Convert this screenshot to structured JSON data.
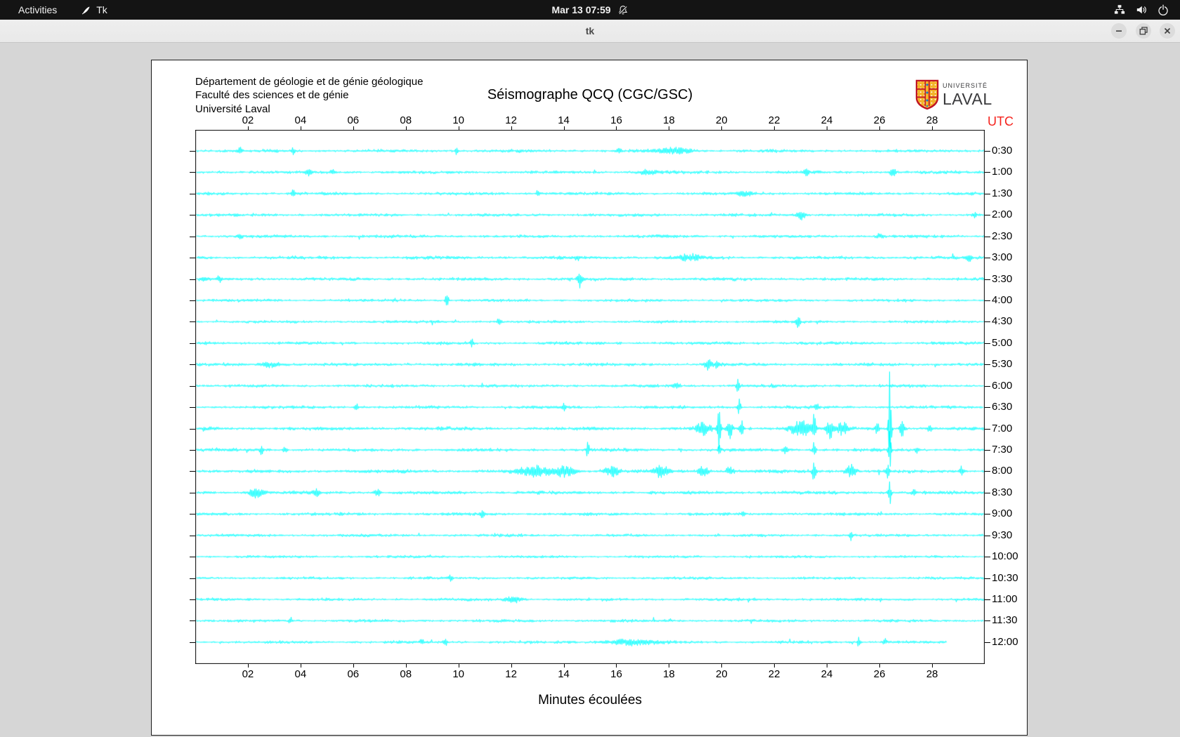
{
  "topbar": {
    "activities_label": "Activities",
    "app_name": "Tk",
    "clock": "Mar 13 07:59",
    "icons": [
      "tk-feather-icon",
      "bell-slash-icon",
      "wired-network-icon",
      "speaker-volume-icon",
      "power-icon"
    ]
  },
  "titlebar": {
    "title": "tk"
  },
  "header": {
    "org_line1": "Département de géologie et de génie géologique",
    "org_line2": "Faculté des sciences et de génie",
    "org_line3": "Université Laval",
    "title": "Séismographe QCQ (CGC/GSC)"
  },
  "logo": {
    "top": "UNIVERSITÉ",
    "bottom": "LAVAL",
    "shield_red": "#c01423",
    "shield_gold": "#f3b229",
    "shield_blue": "#1878be"
  },
  "axes": {
    "utc_label": "UTC",
    "utc_color": "#f5231d",
    "x_caption": "Minutes écoulées",
    "x_ticks": [
      "02",
      "04",
      "06",
      "08",
      "10",
      "12",
      "14",
      "16",
      "18",
      "20",
      "22",
      "24",
      "26",
      "28"
    ]
  },
  "chart_data": {
    "type": "line",
    "title": "Séismographe QCQ (CGC/GSC)",
    "x_label": "Minutes écoulées",
    "x_range_minutes": [
      0,
      30
    ],
    "x_tick_minutes": [
      2,
      4,
      6,
      8,
      10,
      12,
      14,
      16,
      18,
      20,
      22,
      24,
      26,
      28
    ],
    "trace_color": "#00ffff",
    "row_interval": "30 minutes per trace, labels 0:30 to 12:00 UTC",
    "rows": [
      {
        "label": "0:30",
        "end": 30,
        "amp": 1.6,
        "events": [
          [
            1.7,
            4,
            0.05
          ],
          [
            3.7,
            4,
            0.05
          ],
          [
            9.9,
            4,
            0.05
          ],
          [
            16.1,
            4,
            0.05
          ],
          [
            18.2,
            4,
            0.45
          ]
        ]
      },
      {
        "label": "1:00",
        "end": 30,
        "amp": 1.6,
        "events": [
          [
            4.3,
            5,
            0.07
          ],
          [
            5.2,
            4,
            0.05
          ],
          [
            17.2,
            3,
            0.3
          ],
          [
            23.2,
            4,
            0.07
          ],
          [
            26.5,
            7,
            0.07
          ]
        ]
      },
      {
        "label": "1:30",
        "end": 30,
        "amp": 1.6,
        "events": [
          [
            3.7,
            5,
            0.05
          ],
          [
            13.0,
            4,
            0.05
          ],
          [
            20.9,
            3,
            0.2
          ]
        ]
      },
      {
        "label": "2:00",
        "end": 30,
        "amp": 1.6,
        "events": [
          [
            23.0,
            7,
            0.12
          ],
          [
            29.6,
            5,
            0.05
          ]
        ]
      },
      {
        "label": "2:30",
        "end": 30,
        "amp": 1.6,
        "events": [
          [
            1.7,
            5,
            0.05
          ],
          [
            26.0,
            3,
            0.1
          ]
        ]
      },
      {
        "label": "3:00",
        "end": 30,
        "amp": 1.7,
        "events": [
          [
            14.5,
            5,
            0.05
          ],
          [
            18.8,
            4,
            0.35
          ],
          [
            29.4,
            8,
            0.05
          ]
        ]
      },
      {
        "label": "3:30",
        "end": 30,
        "amp": 1.7,
        "events": [
          [
            0.3,
            5,
            0.07
          ],
          [
            0.9,
            4,
            0.05
          ],
          [
            14.6,
            11,
            0.05
          ]
        ]
      },
      {
        "label": "4:00",
        "end": 30,
        "amp": 1.5,
        "events": [
          [
            9.55,
            11,
            0.04
          ]
        ]
      },
      {
        "label": "4:30",
        "end": 30,
        "amp": 1.5,
        "events": [
          [
            11.5,
            5,
            0.05
          ],
          [
            22.9,
            8,
            0.06
          ]
        ]
      },
      {
        "label": "5:00",
        "end": 30,
        "amp": 1.6,
        "events": [
          [
            10.5,
            6,
            0.04
          ]
        ]
      },
      {
        "label": "5:30",
        "end": 30,
        "amp": 1.7,
        "events": [
          [
            2.9,
            4,
            0.25
          ],
          [
            19.5,
            8,
            0.1
          ],
          [
            19.8,
            7,
            0.05
          ]
        ]
      },
      {
        "label": "6:00",
        "end": 30,
        "amp": 1.6,
        "events": [
          [
            18.3,
            4,
            0.1
          ],
          [
            20.6,
            8,
            0.04
          ]
        ]
      },
      {
        "label": "6:30",
        "end": 30,
        "amp": 1.6,
        "events": [
          [
            6.1,
            5,
            0.05
          ],
          [
            14.0,
            5,
            0.04
          ],
          [
            20.65,
            12,
            0.04
          ],
          [
            23.6,
            6,
            0.05
          ]
        ]
      },
      {
        "label": "7:00",
        "end": 30,
        "amp": 1.8,
        "events": [
          [
            19.3,
            10,
            0.18
          ],
          [
            19.9,
            48,
            0.04
          ],
          [
            20.3,
            14,
            0.06
          ],
          [
            20.75,
            12,
            0.05
          ],
          [
            23.0,
            12,
            0.28
          ],
          [
            23.5,
            22,
            0.04
          ],
          [
            24.1,
            14,
            0.09
          ],
          [
            24.6,
            9,
            0.14
          ],
          [
            25.9,
            8,
            0.05
          ],
          [
            26.38,
            85,
            0.035
          ],
          [
            26.85,
            11,
            0.06
          ],
          [
            27.9,
            7,
            0.05
          ]
        ]
      },
      {
        "label": "7:30",
        "end": 30,
        "amp": 1.7,
        "events": [
          [
            2.5,
            6,
            0.05
          ],
          [
            3.4,
            5,
            0.05
          ],
          [
            14.9,
            12,
            0.04
          ],
          [
            19.9,
            6,
            0.05
          ],
          [
            22.4,
            9,
            0.05
          ],
          [
            23.5,
            14,
            0.04
          ],
          [
            26.38,
            28,
            0.035
          ],
          [
            27.4,
            6,
            0.05
          ]
        ]
      },
      {
        "label": "8:00",
        "end": 30,
        "amp": 1.8,
        "events": [
          [
            12.9,
            7,
            0.45
          ],
          [
            14.0,
            7,
            0.28
          ],
          [
            15.8,
            7,
            0.22
          ],
          [
            17.7,
            8,
            0.18
          ],
          [
            19.3,
            7,
            0.14
          ],
          [
            20.3,
            7,
            0.1
          ],
          [
            23.5,
            13,
            0.05
          ],
          [
            24.9,
            9,
            0.14
          ],
          [
            26.3,
            15,
            0.04
          ],
          [
            29.1,
            7,
            0.05
          ]
        ]
      },
      {
        "label": "8:30",
        "end": 30,
        "amp": 1.8,
        "events": [
          [
            2.3,
            7,
            0.18
          ],
          [
            4.6,
            5,
            0.07
          ],
          [
            6.9,
            6,
            0.07
          ],
          [
            26.38,
            20,
            0.035
          ],
          [
            27.3,
            6,
            0.05
          ]
        ]
      },
      {
        "label": "9:00",
        "end": 30,
        "amp": 1.6,
        "events": [
          [
            10.9,
            5,
            0.06
          ],
          [
            20.8,
            6,
            0.04
          ]
        ]
      },
      {
        "label": "9:30",
        "end": 30,
        "amp": 1.5,
        "events": [
          [
            24.9,
            8,
            0.04
          ]
        ]
      },
      {
        "label": "10:00",
        "end": 30,
        "amp": 1.4,
        "events": []
      },
      {
        "label": "10:30",
        "end": 30,
        "amp": 1.4,
        "events": [
          [
            9.7,
            4,
            0.05
          ]
        ]
      },
      {
        "label": "11:00",
        "end": 30,
        "amp": 1.5,
        "events": [
          [
            12.1,
            4,
            0.25
          ]
        ]
      },
      {
        "label": "11:30",
        "end": 30,
        "amp": 1.5,
        "events": [
          [
            3.6,
            5,
            0.04
          ]
        ]
      },
      {
        "label": "12:00",
        "end": 28.55,
        "amp": 1.5,
        "events": [
          [
            8.6,
            5,
            0.05
          ],
          [
            9.5,
            6,
            0.04
          ],
          [
            16.5,
            4,
            0.7
          ],
          [
            25.2,
            7,
            0.04
          ],
          [
            26.2,
            6,
            0.04
          ]
        ]
      }
    ]
  }
}
